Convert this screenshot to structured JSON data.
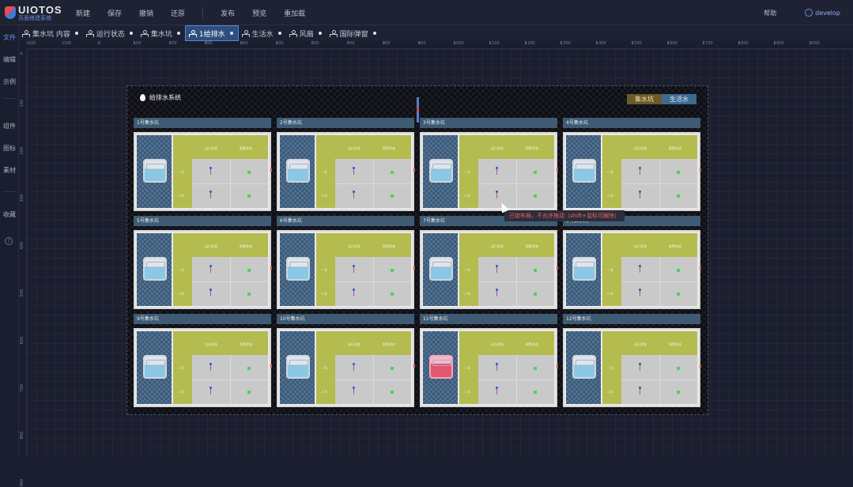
{
  "app": {
    "logo_title": "UIOTOS",
    "logo_sub": "页面搭建系统"
  },
  "menu": [
    "新建",
    "保存",
    "撤销",
    "还原",
    "发布",
    "预览",
    "重加载"
  ],
  "top_right": {
    "help": "帮助",
    "user": "develop"
  },
  "sidebar": [
    "文件",
    "编辑",
    "示例",
    "组件",
    "图标",
    "素材",
    "收藏"
  ],
  "tabs": [
    {
      "label": "集水坑 内容",
      "active": false
    },
    {
      "label": "运行状态",
      "active": false
    },
    {
      "label": "集水坑",
      "active": false
    },
    {
      "label": "1给排水",
      "active": true
    },
    {
      "label": "生活水",
      "active": false
    },
    {
      "label": "风扇",
      "active": false
    },
    {
      "label": "国际弹窗",
      "active": false
    }
  ],
  "ruler_x": [
    "-200",
    "-100",
    "0",
    "100",
    "200",
    "300",
    "400",
    "500",
    "600",
    "700",
    "800",
    "900",
    "1000",
    "1100",
    "1200",
    "1300",
    "1400",
    "1500",
    "1600",
    "1700",
    "1800",
    "1900",
    "2000"
  ],
  "ruler_y": [
    "0",
    "100",
    "200",
    "300",
    "400",
    "500",
    "600",
    "700",
    "800",
    "900"
  ],
  "panel": {
    "title": "给排水系统",
    "seg_a": "集水坑",
    "seg_b": "生活水",
    "col1": "运行状态",
    "col2": "报警状态",
    "row1": "一号",
    "row2": "二号"
  },
  "cards": [
    {
      "title": "1号集水坑",
      "alarm": false
    },
    {
      "title": "2号集水坑",
      "alarm": false
    },
    {
      "title": "3号集水坑",
      "alarm": false
    },
    {
      "title": "4号集水坑",
      "alarm": false
    },
    {
      "title": "5号集水坑",
      "alarm": false
    },
    {
      "title": "6号集水坑",
      "alarm": false
    },
    {
      "title": "7号集水坑",
      "alarm": false
    },
    {
      "title": "8号集水坑",
      "alarm": false
    },
    {
      "title": "9号集水坑",
      "alarm": false
    },
    {
      "title": "10号集水坑",
      "alarm": false
    },
    {
      "title": "11号集水坑",
      "alarm": true
    },
    {
      "title": "12号集水坑",
      "alarm": false
    }
  ],
  "tooltip": "已锁布局，不允许拖动（shift+鼠标可解除）",
  "colors": {
    "accent": "#2c4f80",
    "header": "#3f5b74",
    "table": "#b4bb4f",
    "status_ok": "#49d35e",
    "alarm": "#e2566f"
  }
}
